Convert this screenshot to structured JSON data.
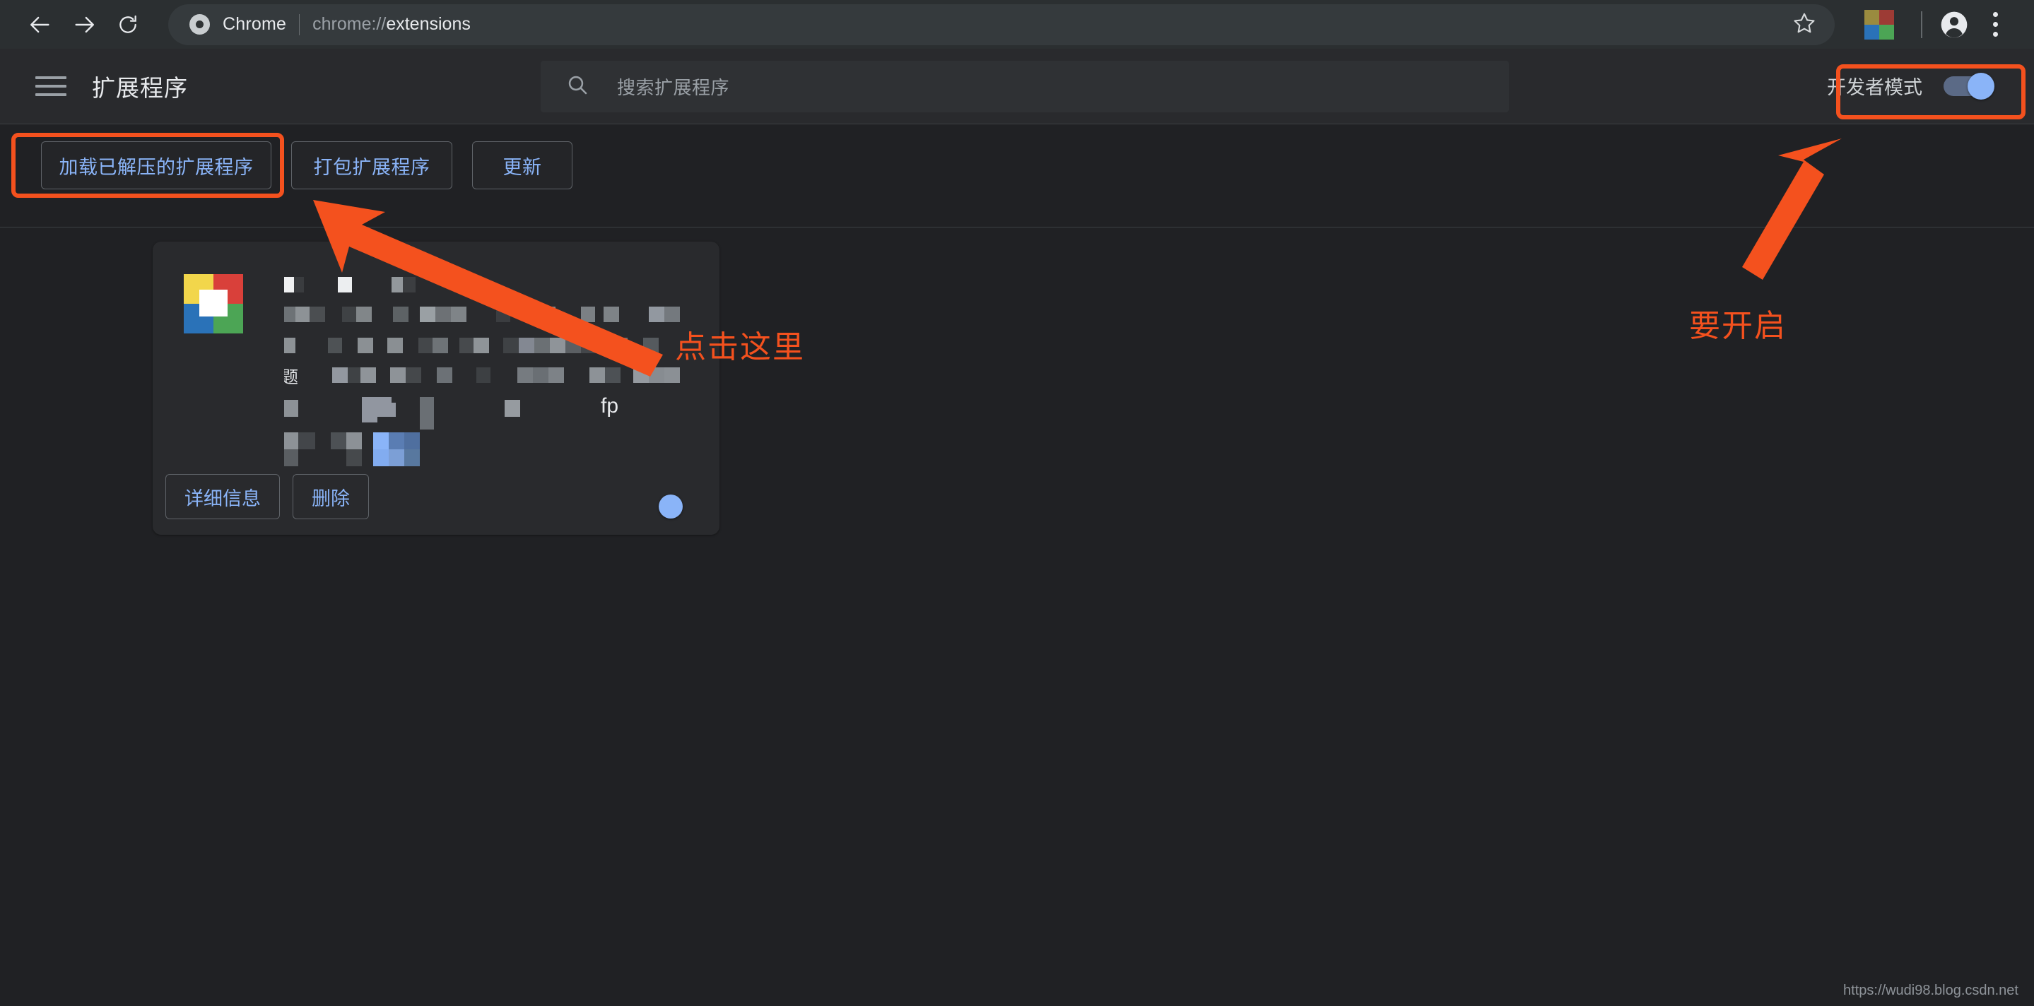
{
  "browser": {
    "nav": {
      "back_icon": "arrow-left-icon",
      "forward_icon": "arrow-right-icon",
      "reload_icon": "reload-icon"
    },
    "omnibox": {
      "chip_icon": "chrome-logo-icon",
      "chip_label": "Chrome",
      "url_scheme": "chrome://",
      "url_path": "extensions",
      "url_full": "chrome://extensions",
      "bookmark_icon": "star-icon"
    },
    "toolbar_right": {
      "extension_icon": "extension-grid-icon",
      "extension_icon_colors": [
        "#9a8b3f",
        "#9d3b35",
        "#2a72b8",
        "#4ca555"
      ],
      "profile_icon": "account-avatar-icon",
      "menu_icon": "three-dot-menu-icon"
    }
  },
  "extensions_page": {
    "menu_icon": "hamburger-menu-icon",
    "title": "扩展程序",
    "search": {
      "icon": "search-icon",
      "placeholder": "搜索扩展程序",
      "value": ""
    },
    "developer_mode": {
      "label": "开发者模式",
      "enabled": true,
      "toggle_color": "#8ab4f8"
    },
    "toolbar_buttons": [
      {
        "id": "load-unpacked",
        "label": "加载已解压的扩展程序"
      },
      {
        "id": "pack-extension",
        "label": "打包扩展程序"
      },
      {
        "id": "update",
        "label": "更新"
      }
    ],
    "card": {
      "icon_name": "extension-tile-icon",
      "icon_colors": [
        "#f2d64b",
        "#d9403a",
        "#2a72b8",
        "#4ca555",
        "#ffffff"
      ],
      "name_redacted": true,
      "redacted_note": "马赛克遮挡的扩展名称与说明",
      "visible_fragments": [
        "题",
        "fp"
      ],
      "buttons": [
        {
          "id": "details",
          "label": "详细信息"
        },
        {
          "id": "remove",
          "label": "删除"
        }
      ],
      "enabled": true,
      "toggle_color": "#8ab4f8"
    }
  },
  "annotations": {
    "accent_color": "#f4511e",
    "boxes": [
      {
        "id": "load-unpacked-highlight",
        "target": "加载已解压的扩展程序"
      },
      {
        "id": "developer-mode-highlight",
        "target": "开发者模式"
      }
    ],
    "labels": [
      {
        "id": "click-here",
        "text": "点击这里"
      },
      {
        "id": "must-enable",
        "text": "要开启"
      }
    ],
    "arrows": [
      {
        "id": "arrow-to-load-unpacked",
        "direction": "up-left"
      },
      {
        "id": "arrow-to-developer-mode",
        "direction": "up-right"
      }
    ]
  },
  "watermark": {
    "text": "https://wudi98.blog.csdn.net"
  },
  "theme": {
    "toolbar_bg": "#2b2f31",
    "header_bg": "#292a2d",
    "page_bg": "#202124",
    "card_bg": "#292a2d",
    "link_blue": "#8ab4f8",
    "text_primary": "#e8eaed",
    "text_secondary": "#9aa0a6",
    "divider": "#3c4043"
  }
}
